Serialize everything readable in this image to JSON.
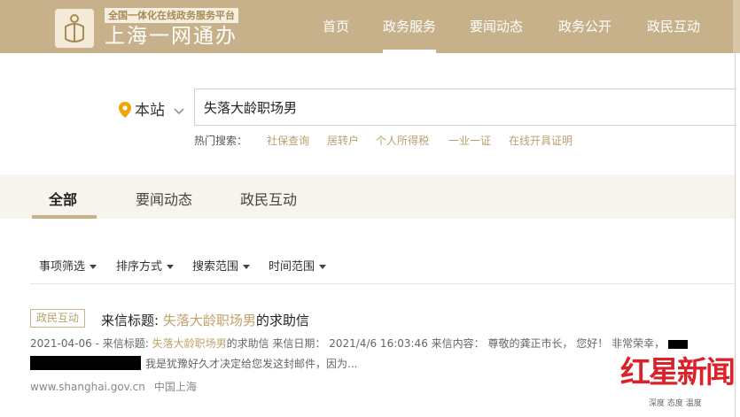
{
  "header": {
    "logo_icon": "shanghai-emblem-icon",
    "logo_tag": "全国一体化在线政务服务平台",
    "logo_title": "上海一网通办",
    "nav": [
      "首页",
      "政务服务",
      "要闻动态",
      "政务公开",
      "政民互动"
    ],
    "active_nav": "政务服务",
    "background": "#c7b18a"
  },
  "search": {
    "location_icon": "location-pin-icon",
    "location_label": "本站",
    "query": "失落大龄职场男",
    "hot_label": "热门搜索：",
    "hot_links": [
      "社保查询",
      "居转户",
      "个人所得税",
      "一业一证",
      "在线开具证明"
    ]
  },
  "tabs": {
    "items": [
      "全部",
      "要闻动态",
      "政民互动"
    ],
    "active": "全部"
  },
  "filters": [
    "事项筛选",
    "排序方式",
    "搜索范围",
    "时间范围"
  ],
  "result": {
    "badge": "政民互动",
    "title_prefix": "来信标题: ",
    "title_highlight": "失落大龄职场男",
    "title_suffix": "的求助信",
    "meta_date": "2021-04-06 -",
    "meta_title_label": "来信标题: ",
    "meta_title_highlight": "失落大龄职场男",
    "meta_rest": "的求助信 来信日期： 2021/4/6 16:03:46 来信内容： 尊敬的龚正市长， 您好！ 非常荣幸，",
    "meta_line2": "我是犹豫好久才决定给您发这封邮件，因为...",
    "url": "www.shanghai.gov.cn",
    "source": "中国上海"
  },
  "watermark": {
    "main": "红星新闻",
    "sub": "深度 态度 温度"
  },
  "colors": {
    "accent": "#c7b18a",
    "highlight": "#c0a26a",
    "watermark_red": "#d8232a"
  }
}
